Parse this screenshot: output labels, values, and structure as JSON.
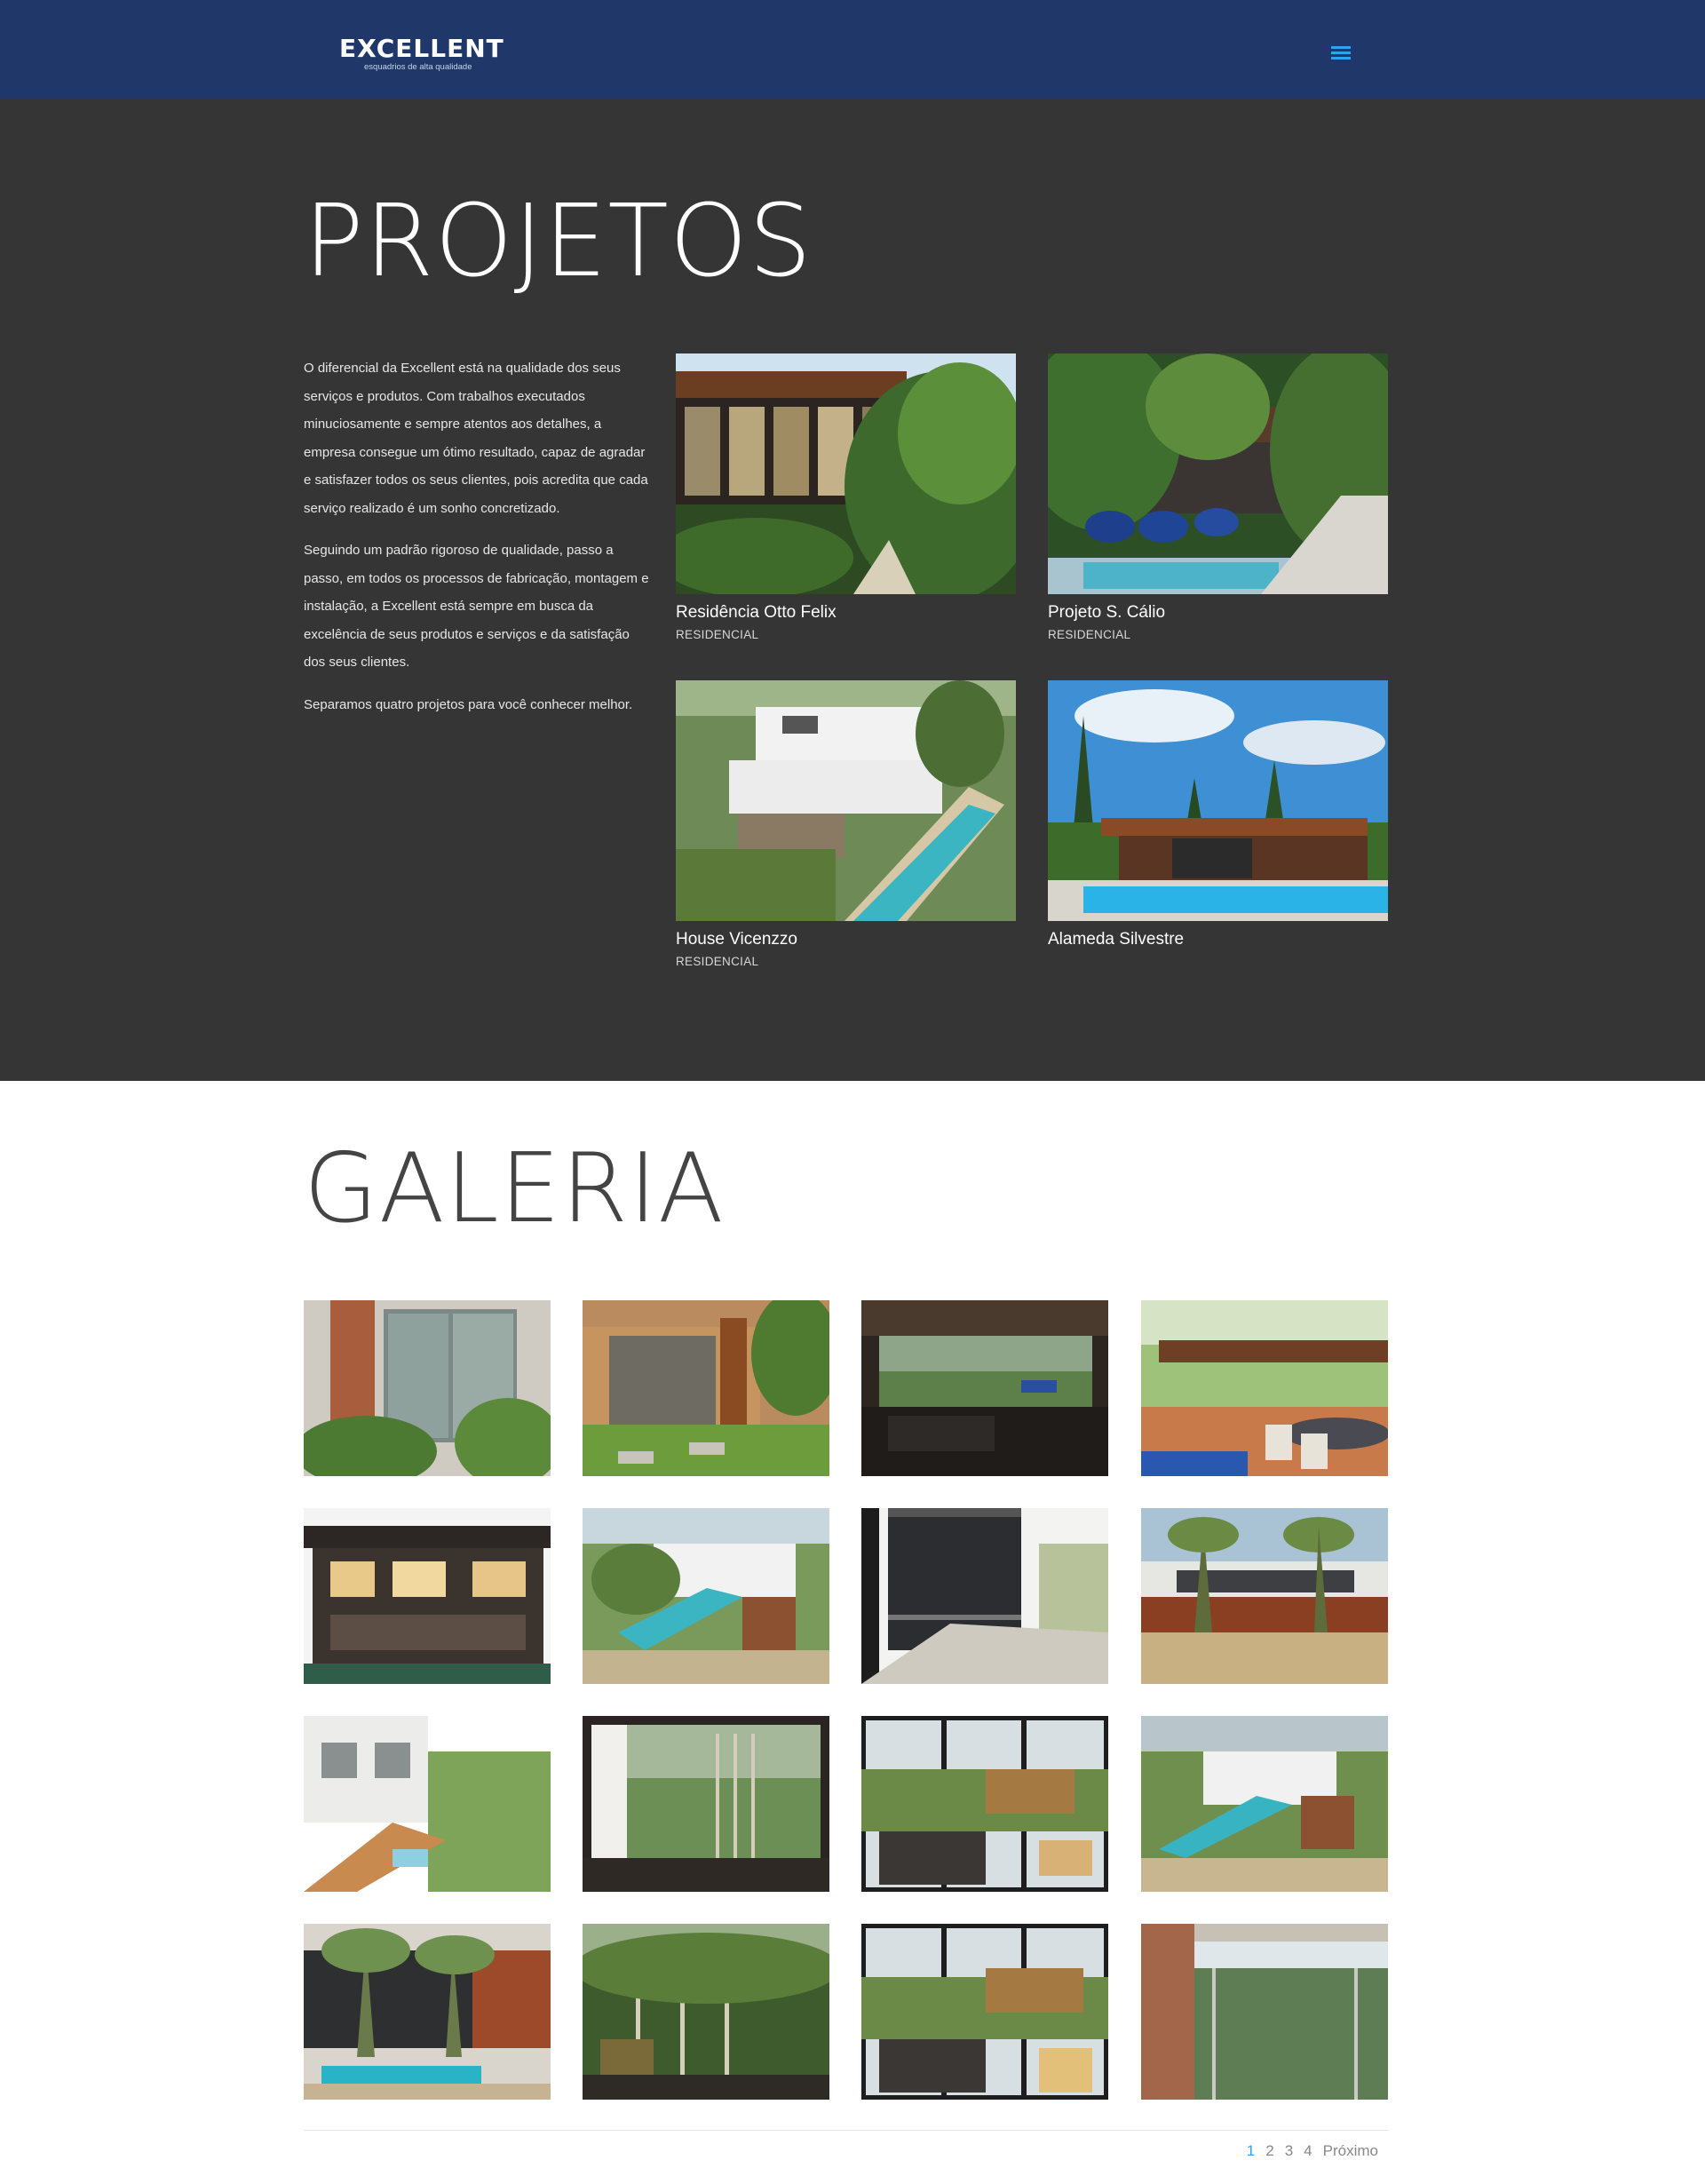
{
  "header": {
    "logo_text": "EXCELLENT",
    "logo_tagline": "esquadrios de alta qualidade"
  },
  "projects": {
    "title": "PROJETOS",
    "intro": [
      "O diferencial da Excellent está na qualidade dos seus serviços e produtos. Com trabalhos executados minuciosamente e sempre atentos aos detalhes, a empresa consegue um ótimo resultado, capaz de agradar e satisfazer todos os seus clientes, pois acredita que cada serviço realizado é um sonho concretizado.",
      "Seguindo um padrão rigoroso de qualidade, passo a passo, em todos os processos de fabricação, montagem e instalação, a Excellent está sempre em busca da excelência de seus produtos e serviços e da satisfação dos seus clientes.",
      "Separamos quatro projetos para você conhecer melhor."
    ],
    "items": [
      {
        "name": "Residência Otto Felix",
        "category": "RESIDENCIAL"
      },
      {
        "name": "Projeto S. Cálio",
        "category": "RESIDENCIAL"
      },
      {
        "name": "House Vicenzzo",
        "category": "RESIDENCIAL"
      },
      {
        "name": "Alameda Silvestre",
        "category": ""
      }
    ]
  },
  "gallery": {
    "title": "GALERIA",
    "thumb_count": 16
  },
  "pagination": {
    "pages": [
      "1",
      "2",
      "3",
      "4"
    ],
    "next": "Próximo",
    "active": "1"
  }
}
